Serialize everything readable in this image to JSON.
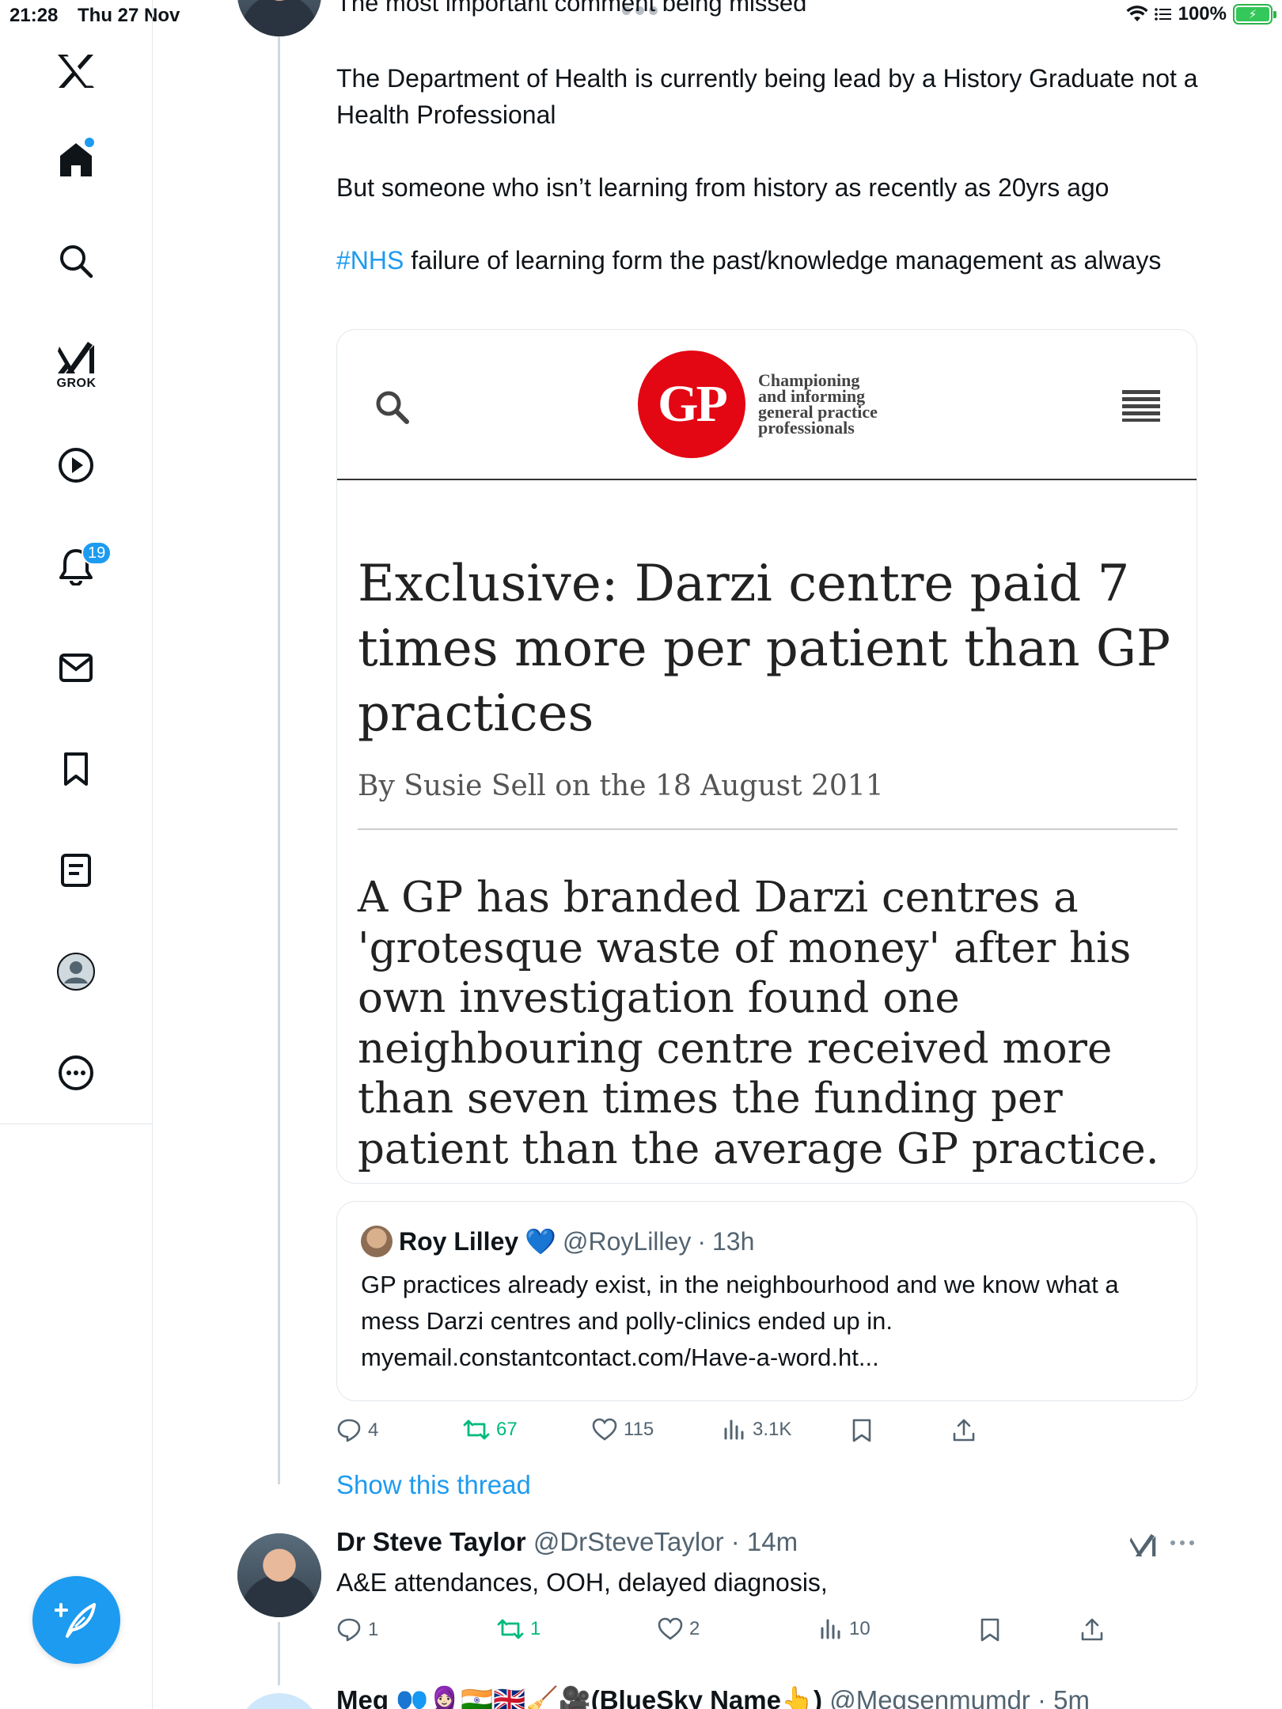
{
  "status_bar": {
    "time": "21:28",
    "date": "Thu 27 Nov",
    "battery": "100%"
  },
  "sidebar": {
    "items": [
      {
        "name": "x-logo",
        "icon": "x-logo-icon"
      },
      {
        "name": "home",
        "icon": "home-icon"
      },
      {
        "name": "search",
        "icon": "search-icon"
      },
      {
        "name": "grok",
        "icon": "grok-icon",
        "label": "GROK"
      },
      {
        "name": "video",
        "icon": "play-icon"
      },
      {
        "name": "notifications",
        "icon": "bell-icon",
        "badge": "19"
      },
      {
        "name": "messages",
        "icon": "mail-icon"
      },
      {
        "name": "bookmarks",
        "icon": "bookmark-icon"
      },
      {
        "name": "lists",
        "icon": "list-icon"
      },
      {
        "name": "profile",
        "icon": "avatar-icon"
      },
      {
        "name": "more",
        "icon": "more-circle-icon"
      }
    ],
    "compose_icon": "compose-icon",
    "accent": "#1d9bf0"
  },
  "main_tweet": {
    "header_fragment": "The most important comment being missed",
    "paragraphs": [
      "The Department of Health is currently being lead by a History Graduate not a Health Professional",
      "But someone who isn’t learning from history as recently as 20yrs ago"
    ],
    "hashtag": "#NHS",
    "hashtag_rest": " failure of learning form the past/knowledge management as always",
    "card": {
      "logo_text": "GP",
      "tagline": [
        "Championing",
        "and informing",
        "general practice",
        "professionals"
      ],
      "headline": "Exclusive: Darzi centre paid 7 times more per patient than GP practices",
      "byline": "By Susie Sell on the 18 August 2011",
      "standfirst": "A GP has branded Darzi centres a 'grotesque waste of money' after his own investigation found one neighbouring centre received more than seven times the funding per patient than the average GP practice.",
      "brand_color": "#e30613"
    },
    "quote": {
      "name": "Roy Lilley",
      "emoji": "💙",
      "handle": "@RoyLilley",
      "time": "13h",
      "text": "GP practices already exist, in the neighbourhood and we know what a mess Darzi centres and polly-clinics ended up in. myemail.constantcontact.com/Have-a-word.ht..."
    },
    "stats": {
      "replies": "4",
      "reposts": "67",
      "likes": "115",
      "views": "3.1K"
    },
    "show_thread": "Show this thread"
  },
  "reply": {
    "name": "Dr Steve Taylor",
    "handle": "@DrSteveTaylor",
    "time": "14m",
    "text": "A&E attendances, OOH, delayed diagnosis,",
    "stats": {
      "replies": "1",
      "reposts": "1",
      "likes": "2",
      "views": "10"
    }
  },
  "next_tweet": {
    "name": "Meg 👥🧕🏻🇮🇳🇬🇧🧹🎥(BlueSky Name👆)",
    "handle": "@Megsenmumdr",
    "time": "5m"
  },
  "colors": {
    "text": "#0f1419",
    "secondary": "#536471",
    "repost_green": "#00ba7c",
    "link_blue": "#1d9bf0"
  }
}
